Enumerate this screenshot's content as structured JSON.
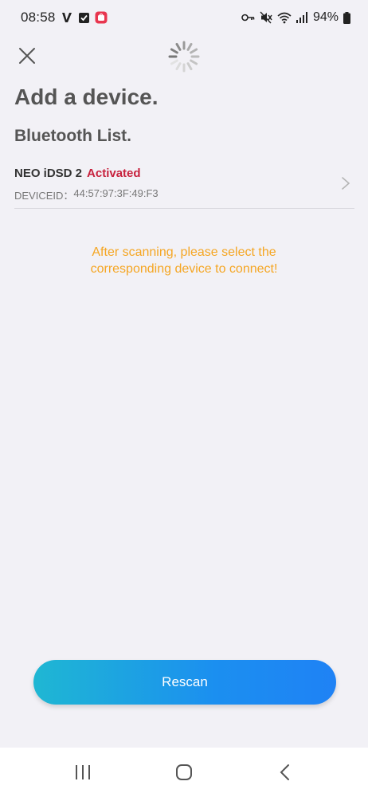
{
  "status_bar": {
    "time": "08:58",
    "battery": "94%"
  },
  "header": {
    "title": "Add a device.",
    "subtitle": "Bluetooth List."
  },
  "devices": [
    {
      "name": "NEO iDSD 2",
      "status": "Activated",
      "id_label": "DEVICEID：",
      "id_value": "44:57:97:3F:49:F3"
    }
  ],
  "hint": {
    "line1": "After scanning, please select the",
    "line2": "corresponding device to connect!"
  },
  "actions": {
    "rescan_label": "Rescan"
  },
  "colors": {
    "accent_status": "#c7213d",
    "hint": "#f5a623",
    "button_gradient_start": "#1fb7d3",
    "button_gradient_end": "#1f82f5"
  },
  "icons": {
    "close": "close-icon",
    "loading": "loading-spinner-icon",
    "chevron": "chevron-right-icon",
    "nav_recents": "recents-icon",
    "nav_home": "home-icon",
    "nav_back": "back-icon"
  }
}
